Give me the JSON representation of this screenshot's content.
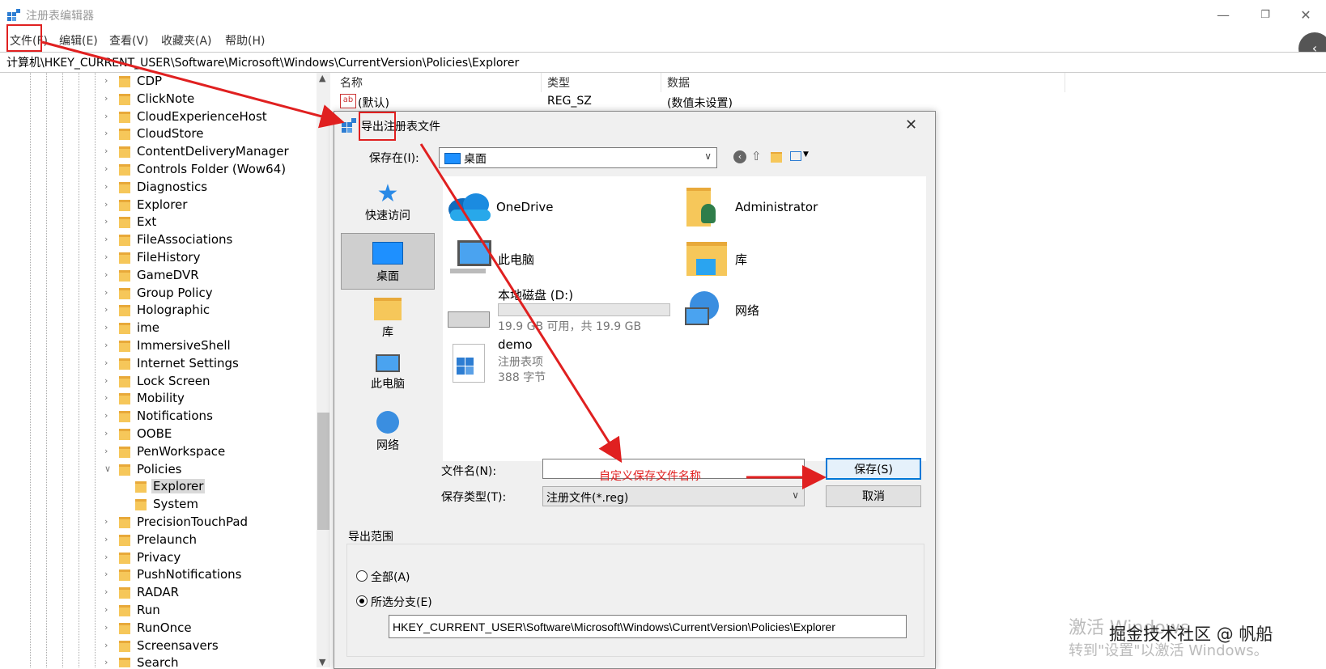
{
  "window": {
    "title": "注册表编辑器",
    "minimize_glyph": "—",
    "restore_glyph": "❐",
    "close_glyph": "✕",
    "side_handle_glyph": "‹"
  },
  "menu": [
    "文件(F)",
    "编辑(E)",
    "查看(V)",
    "收藏夹(A)",
    "帮助(H)"
  ],
  "address": "计算机\\HKEY_CURRENT_USER\\Software\\Microsoft\\Windows\\CurrentVersion\\Policies\\Explorer",
  "tree": {
    "items": [
      "CDP",
      "ClickNote",
      "CloudExperienceHost",
      "CloudStore",
      "ContentDeliveryManager",
      "Controls Folder (Wow64)",
      "Diagnostics",
      "Explorer",
      "Ext",
      "FileAssociations",
      "FileHistory",
      "GameDVR",
      "Group Policy",
      "Holographic",
      "ime",
      "ImmersiveShell",
      "Internet Settings",
      "Lock Screen",
      "Mobility",
      "Notifications",
      "OOBE",
      "PenWorkspace",
      "Policies"
    ],
    "children": [
      "Explorer",
      "System"
    ],
    "after": [
      "PrecisionTouchPad",
      "Prelaunch",
      "Privacy",
      "PushNotifications",
      "RADAR",
      "Run",
      "RunOnce",
      "Screensavers",
      "Search"
    ],
    "expanded_glyph": "∨",
    "collapsed_glyph": "›"
  },
  "list": {
    "headers": [
      "名称",
      "类型",
      "数据"
    ],
    "rows": [
      {
        "name": "(默认)",
        "type": "REG_SZ",
        "data": "(数值未设置)"
      }
    ],
    "value_icon_text": "ab"
  },
  "dialog": {
    "title": "导出注册表文件",
    "close_glyph": "✕",
    "save_in_label": "保存在(I):",
    "save_in_value": "桌面",
    "places": [
      "快速访问",
      "桌面",
      "库",
      "此电脑",
      "网络"
    ],
    "files": [
      {
        "name": "OneDrive"
      },
      {
        "name": "Administrator"
      },
      {
        "name": "此电脑"
      },
      {
        "name": "库"
      },
      {
        "name": "本地磁盘 (D:)",
        "detail": "19.9 GB 可用，共 19.9 GB",
        "used_fraction": 0.0
      },
      {
        "name": "网络"
      },
      {
        "name": "demo",
        "type": "注册表项",
        "size": "388 字节"
      }
    ],
    "filename_label": "文件名(N):",
    "filename_value": "",
    "filetype_label": "保存类型(T):",
    "filetype_value": "注册文件(*.reg)",
    "save_button": "保存(S)",
    "cancel_button": "取消",
    "export_range_label": "导出范围",
    "option_all": "全部(A)",
    "option_selected": "所选分支(E)",
    "selected_branch": "HKEY_CURRENT_USER\\Software\\Microsoft\\Windows\\CurrentVersion\\Policies\\Explorer"
  },
  "annotation": {
    "text": "自定义保存文件名称",
    "color": "#e02020"
  },
  "watermarks": {
    "activate_line1": "激活 Windows",
    "activate_line2": "转到\"设置\"以激活 Windows。",
    "community": "掘金技术社区 @ 帆船"
  }
}
